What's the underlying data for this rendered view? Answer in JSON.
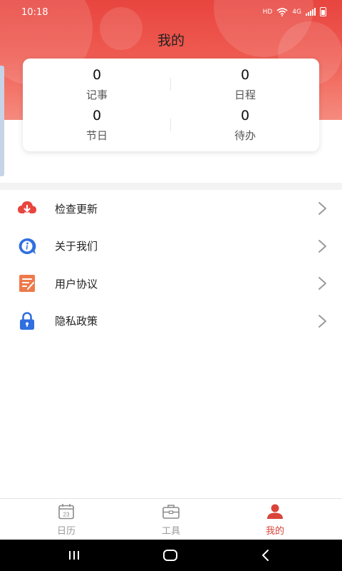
{
  "status_bar": {
    "time": "10:18",
    "network_hd": "HD",
    "network_gen": "4G"
  },
  "page": {
    "title": "我的"
  },
  "stats": [
    {
      "value": "0",
      "label": "记事"
    },
    {
      "value": "0",
      "label": "日程"
    },
    {
      "value": "0",
      "label": "节日"
    },
    {
      "value": "0",
      "label": "待办"
    }
  ],
  "menu": [
    {
      "label": "检查更新",
      "icon": "cloud-download-icon"
    },
    {
      "label": "关于我们",
      "icon": "info-icon"
    },
    {
      "label": "用户协议",
      "icon": "document-edit-icon"
    },
    {
      "label": "隐私政策",
      "icon": "lock-icon"
    }
  ],
  "bottom_nav": [
    {
      "label": "日历",
      "icon": "calendar-icon",
      "badge": "23",
      "active": false
    },
    {
      "label": "工具",
      "icon": "toolbox-icon",
      "active": false
    },
    {
      "label": "我的",
      "icon": "person-icon",
      "active": true
    }
  ],
  "colors": {
    "header": "#e8453f",
    "active": "#d9433a",
    "inactive": "#999999"
  }
}
